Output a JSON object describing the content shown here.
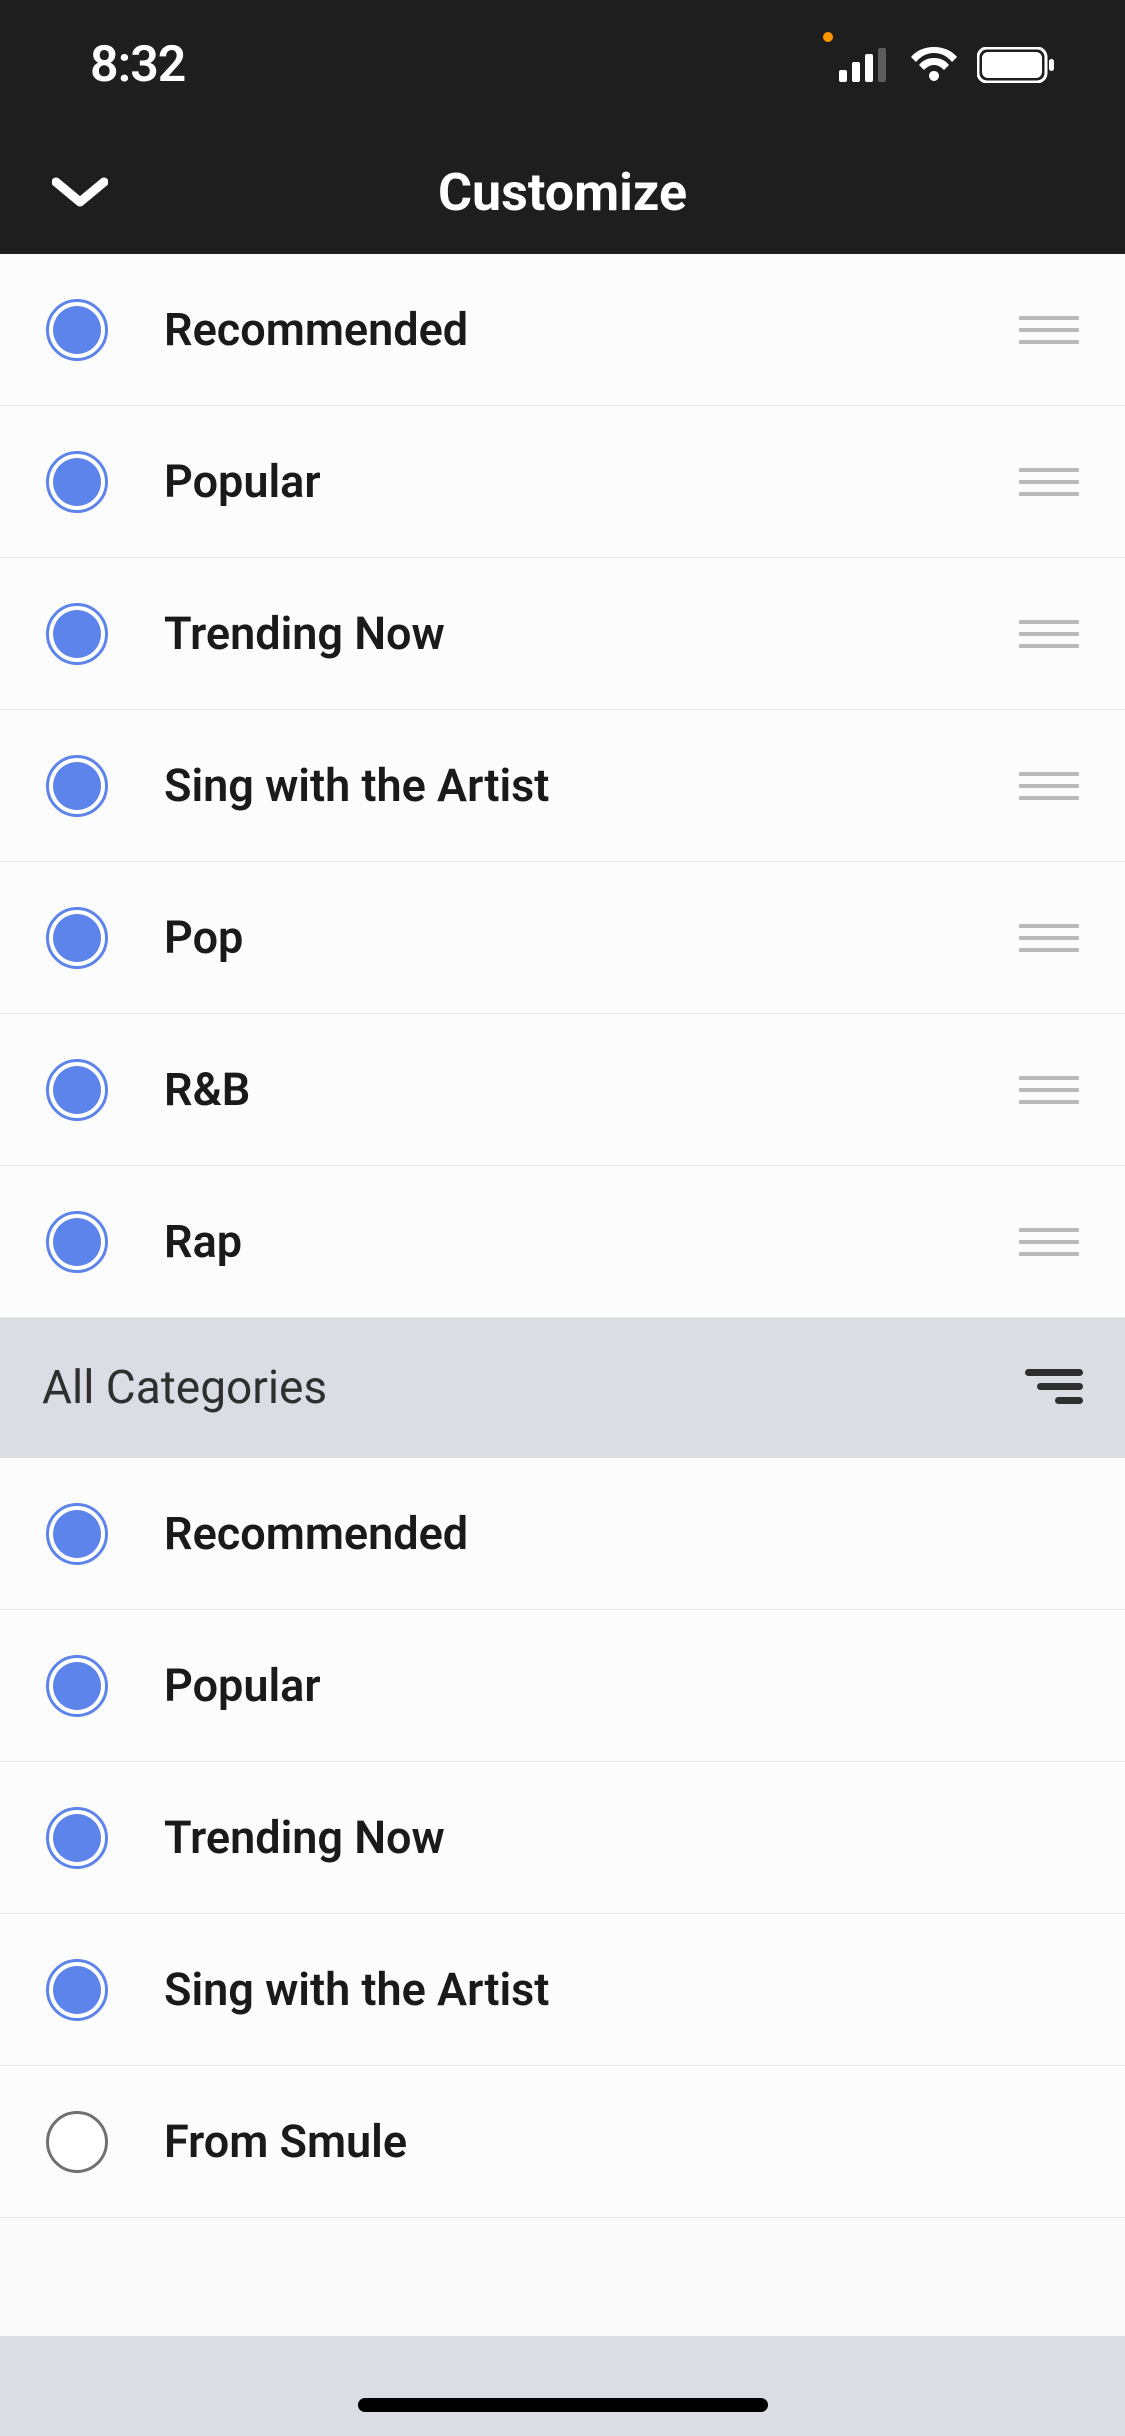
{
  "status": {
    "time": "8:32"
  },
  "header": {
    "title": "Customize"
  },
  "reorderList": [
    {
      "label": "Recommended",
      "selected": true
    },
    {
      "label": "Popular",
      "selected": true
    },
    {
      "label": "Trending Now",
      "selected": true
    },
    {
      "label": "Sing with the Artist",
      "selected": true
    },
    {
      "label": "Pop",
      "selected": true
    },
    {
      "label": "R&B",
      "selected": true
    },
    {
      "label": "Rap",
      "selected": true
    }
  ],
  "section": {
    "title": "All Categories"
  },
  "allCategories": [
    {
      "label": "Recommended",
      "selected": true
    },
    {
      "label": "Popular",
      "selected": true
    },
    {
      "label": "Trending Now",
      "selected": true
    },
    {
      "label": "Sing with the Artist",
      "selected": true
    },
    {
      "label": "From Smule",
      "selected": false
    }
  ]
}
